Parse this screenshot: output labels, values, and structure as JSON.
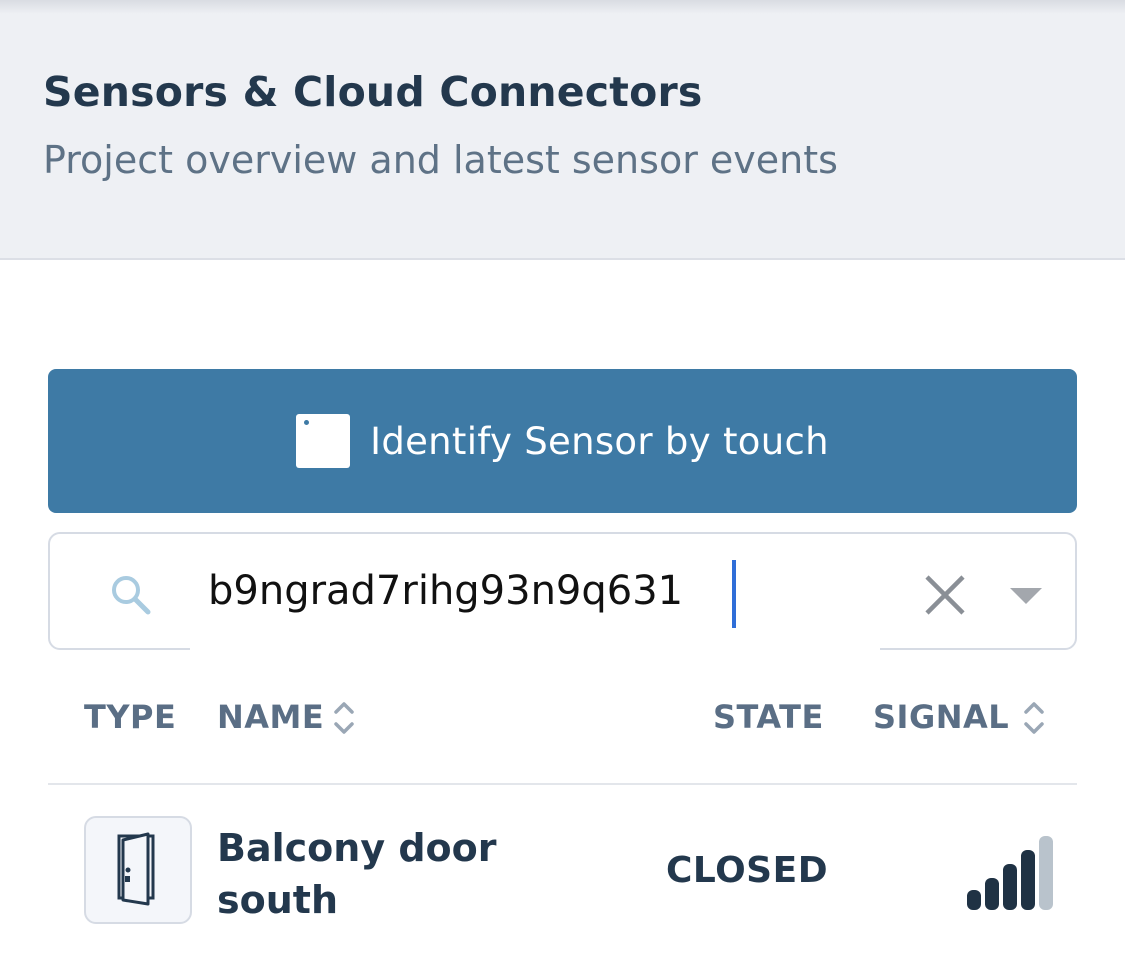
{
  "header": {
    "title": "Sensors & Cloud Connectors",
    "subtitle": "Project overview and latest sensor events"
  },
  "identify_button": {
    "label": "Identify Sensor by touch"
  },
  "search": {
    "value": "b9ngrad7rihg93n9q631",
    "placeholder": ""
  },
  "table": {
    "columns": {
      "type": "TYPE",
      "name": "NAME",
      "state": "STATE",
      "signal": "SIGNAL"
    },
    "rows": [
      {
        "type_icon": "door-icon",
        "name": "Balcony door south",
        "state": "CLOSED",
        "signal_level": 3,
        "signal_max": 4
      }
    ]
  },
  "colors": {
    "accent": "#3e7aa5",
    "header_bg": "#eef0f4",
    "text_dark": "#23384d",
    "text_muted": "#5a6e85",
    "signal_active": "#1f3244",
    "signal_inactive": "#b9c3cc",
    "caret": "#2f6ed8"
  }
}
